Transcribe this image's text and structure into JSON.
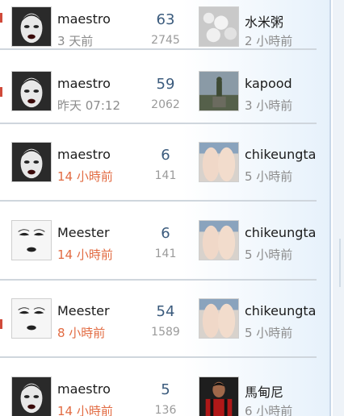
{
  "rows": [
    {
      "author": "maestro",
      "author_time": "3 天前",
      "replies": "63",
      "views": "2745",
      "last_user": "水米粥",
      "last_time": "2 小時前"
    },
    {
      "author": "maestro",
      "author_time": "昨天 07:12",
      "replies": "59",
      "views": "2062",
      "last_user": "kapood",
      "last_time": "3 小時前"
    },
    {
      "author": "maestro",
      "author_time": "14 小時前",
      "replies": "6",
      "views": "141",
      "last_user": "chikeungta",
      "last_time": "5 小時前"
    },
    {
      "author": "Meester",
      "author_time": "14 小時前",
      "replies": "6",
      "views": "141",
      "last_user": "chikeungta",
      "last_time": "5 小時前"
    },
    {
      "author": "Meester",
      "author_time": "8 小時前",
      "replies": "54",
      "views": "1589",
      "last_user": "chikeungta",
      "last_time": "5 小時前"
    },
    {
      "author": "maestro",
      "author_time": "14 小時前",
      "replies": "5",
      "views": "136",
      "last_user": "馬甸尼",
      "last_time": "6 小時前"
    }
  ],
  "colors": {
    "recent_time": "#e26b42",
    "normal_time": "#8c8c8c",
    "replies": "#3b5b7d",
    "divider": "#cfd6dd"
  },
  "icons": {
    "author_avatar_maestro": "woman-face-avatar",
    "author_avatar_meester": "drawn-eyes-lips-avatar",
    "last_rice": "rice-grains-thumb",
    "last_statue": "statue-thumb",
    "last_legs": "legs-thumb",
    "last_player": "football-player-thumb"
  }
}
